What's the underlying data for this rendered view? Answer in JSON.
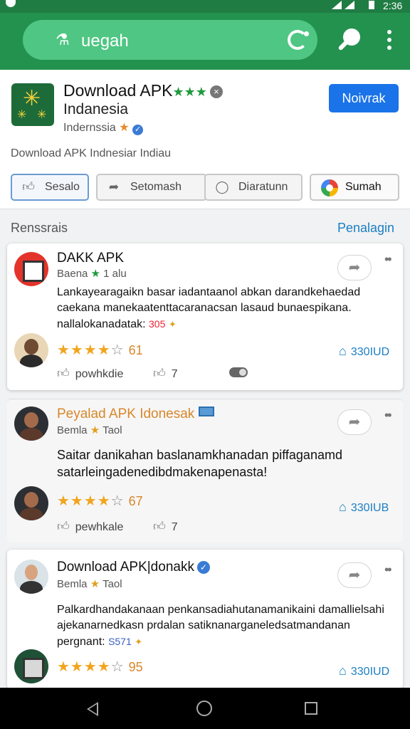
{
  "status": {
    "time": "2:36"
  },
  "search": {
    "value": "uegah"
  },
  "app": {
    "title": "Download APK",
    "title_stars": "★★★",
    "subtitle": "Indanesia",
    "developer": "Indernssia",
    "install_label": "Noivrak",
    "description": "Download APK Indnesiar  Indiau"
  },
  "chips": [
    {
      "label": "Sesalo"
    },
    {
      "label": "Setomash"
    },
    {
      "label": "Diaratunn"
    },
    {
      "label": "Sumah"
    }
  ],
  "reviews_header": {
    "title": "Renssrais",
    "link": "Penalagin"
  },
  "reviews": [
    {
      "name": "DAKK APK",
      "meta": "Baena",
      "meta_rating": "1 alu",
      "body": "Lankayearagaikn basar iadantaanol abkan darandkehaedad caekana manekaatenttacaranacsan lasaud bunaespikana. nallalokanadatak:",
      "body_price": "305",
      "stars": 4,
      "rating_num": "61",
      "price": "330IUD",
      "action1": "powhkdie",
      "action2": "7"
    },
    {
      "name": "Peyalad APK Idonesak",
      "meta": "Bemla",
      "meta_rating": "Taol",
      "body": "Saitar danikahan baslanamkhanadan piffaganamd satarleingadenedibdmakenapenasta!",
      "stars": 4,
      "rating_num": "67",
      "price": "330IUB",
      "action1": "pewhkale",
      "action2": "7"
    },
    {
      "name": "Download APK|donakk",
      "meta": "Bemla",
      "meta_rating": "Taol",
      "body": "Palkardhandakanaan penkansadiahutanamanikaini damallielsahi ajekanarnedkasn prdalan satiknanarganeledsatmandanan pergnant:",
      "body_price": "S571",
      "stars": 4,
      "rating_num": "95",
      "price": "330IUD"
    }
  ],
  "colors": {
    "toolbar": "#23924f",
    "accent": "#1a73e8",
    "star": "#f1a51e"
  }
}
